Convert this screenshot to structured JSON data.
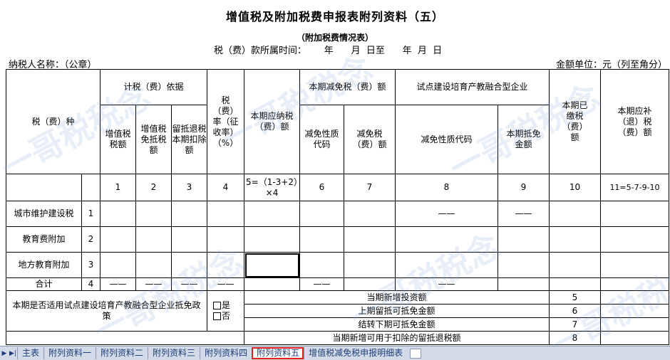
{
  "title": "增值税及附加税费申报表附列资料（五）",
  "subtitle": "（附加税费情况表）",
  "period": "税（费）款所属时间：      年      月  日至      年  月  日",
  "taxpayer": "纳税人名称：（公章）",
  "unit": "金额单位：元（列至角分）",
  "watermark": "一哥税税念",
  "headers": {
    "tax_type": "税（费）种",
    "basis": "计税（费）依据",
    "vat": "增值税税额",
    "vat_exempt": "增值税免抵税额",
    "retained_credit": "留抵退税本期扣除额",
    "rate": "税（费）率（征收率）（%）",
    "payable": "本期应纳税（费）额",
    "reduction": "本期减免税（费）额",
    "reduction_code": "减免性质代码",
    "reduction_amount": "减免税（费）额",
    "pilot": "试点建设培育产教融合型企业",
    "pilot_code": "减免性质代码",
    "pilot_offset": "本期抵免金额",
    "paid": "本期已缴税（费）额",
    "refund": "本期应补（退）税（费）额"
  },
  "col_numbers": [
    "1",
    "2",
    "3",
    "4",
    "5=（1-3+2）×4",
    "6",
    "7",
    "8",
    "9",
    "10",
    "11=5-7-9-10"
  ],
  "rows": [
    {
      "name": "城市维护建设税",
      "no": "1",
      "c8": "——",
      "c9": "——"
    },
    {
      "name": "教育费附加",
      "no": "2"
    },
    {
      "name": "地方教育附加",
      "no": "3"
    }
  ],
  "total": {
    "name": "合计",
    "no": "4",
    "dash": "——"
  },
  "policy": {
    "question": "本期是否适用试点建设培育产教融合型企业抵免政策",
    "yes": "是",
    "no": "否",
    "items": [
      {
        "label": "当期新增投资额",
        "no": "5"
      },
      {
        "label": "上期留抵可抵免金额",
        "no": "6"
      },
      {
        "label": "结转下期可抵免金额",
        "no": "7"
      },
      {
        "label": "当期新增可用于扣除的留抵退税额",
        "no": "8"
      }
    ]
  },
  "tabs": [
    "主表",
    "附列资料一",
    "附列资料二",
    "附列资料三",
    "附列资料四",
    "附列资料五",
    "增值税减免税申报明细表"
  ],
  "active_tab": "附列资料五",
  "colors": {
    "active_tab_outline": "#e02020",
    "tab_bar": "#d4dbe8"
  }
}
